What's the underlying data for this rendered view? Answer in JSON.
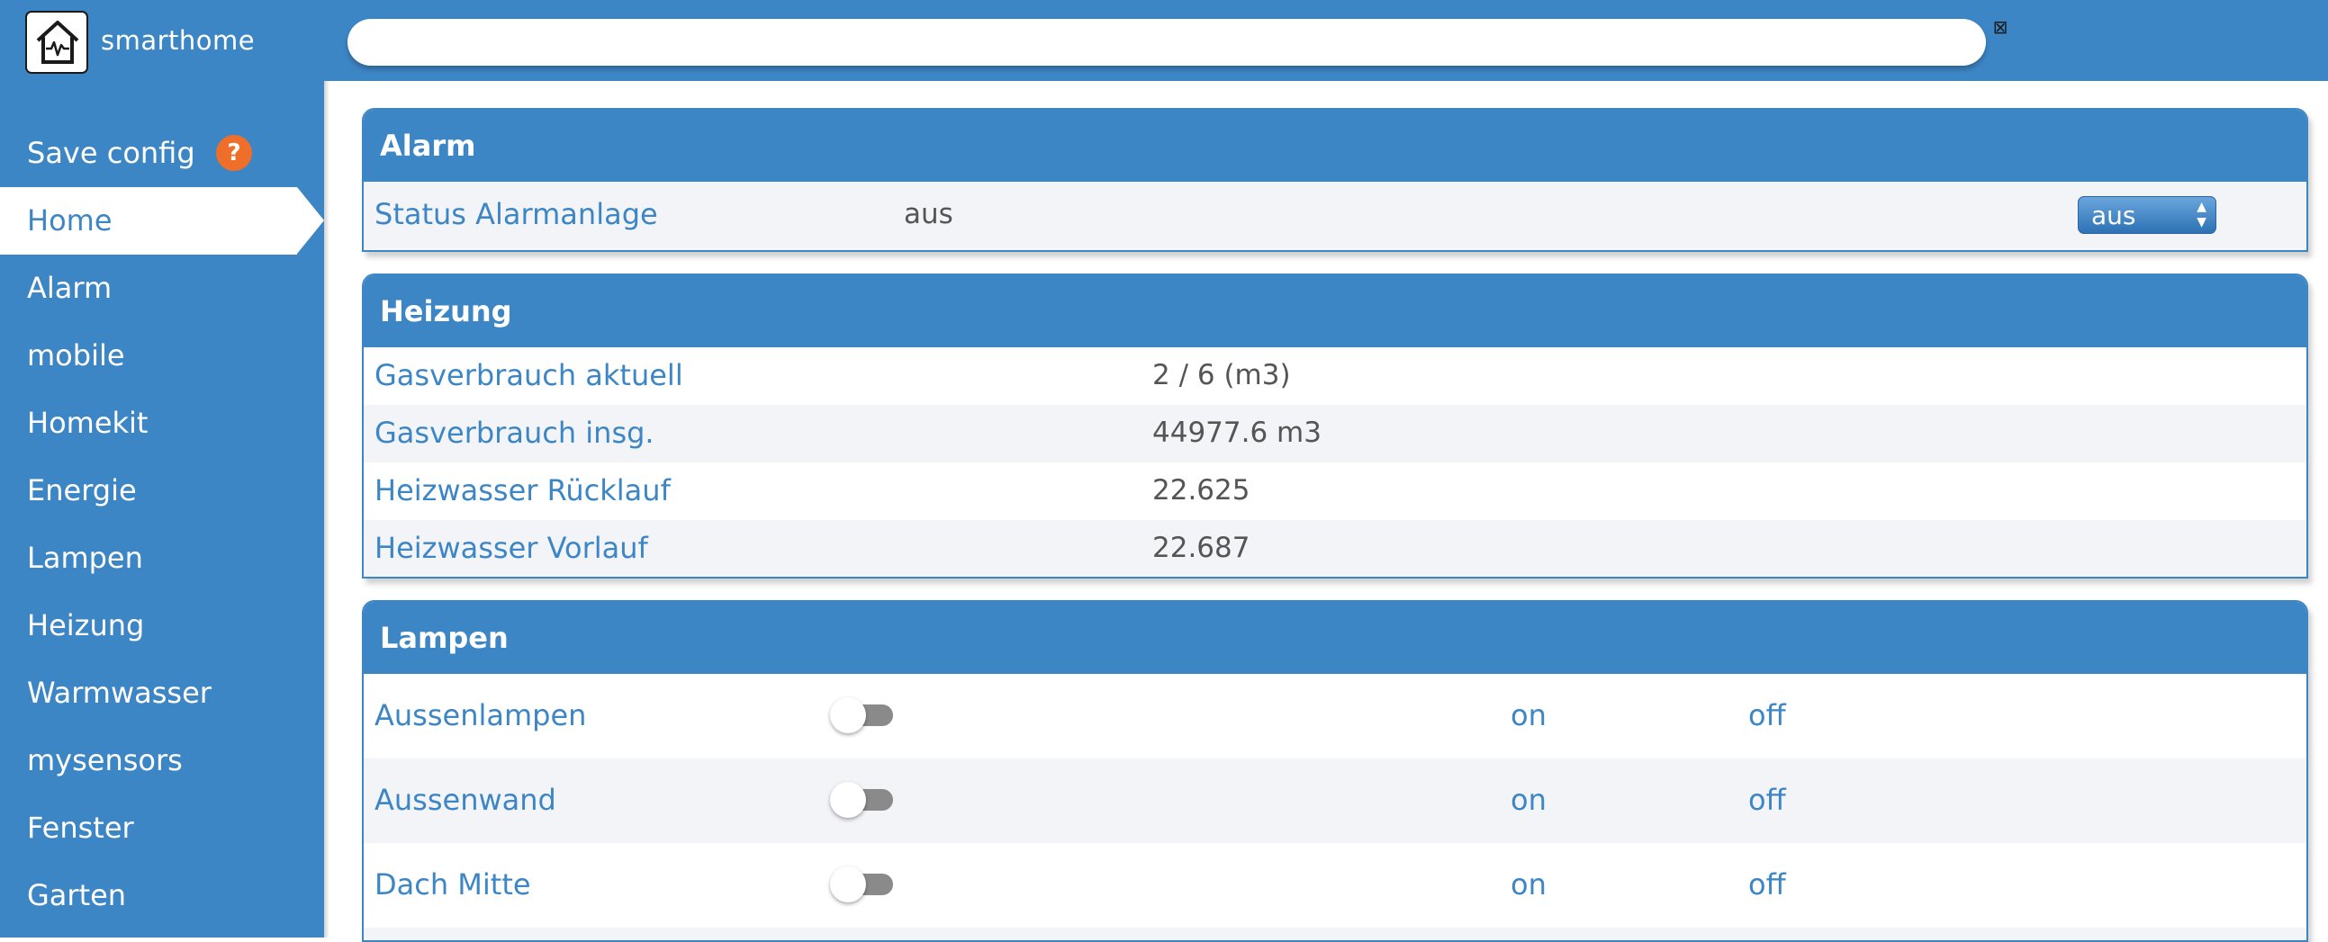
{
  "app": {
    "title": "smarthome",
    "logo_icon": "smarthome-house-icon"
  },
  "search": {
    "value": "",
    "placeholder": "",
    "clear_icon": "clear-x-icon"
  },
  "sidebar": {
    "save_label": "Save config",
    "help_badge": "?",
    "items": [
      {
        "label": "Home",
        "active": true
      },
      {
        "label": "Alarm"
      },
      {
        "label": "mobile"
      },
      {
        "label": "Homekit"
      },
      {
        "label": "Energie"
      },
      {
        "label": "Lampen"
      },
      {
        "label": "Heizung"
      },
      {
        "label": "Warmwasser"
      },
      {
        "label": "mysensors"
      },
      {
        "label": "Fenster"
      },
      {
        "label": "Garten"
      }
    ]
  },
  "alarm": {
    "title": "Alarm",
    "label": "Status Alarmanlage",
    "value": "aus",
    "select_value": "aus"
  },
  "heizung": {
    "title": "Heizung",
    "rows": [
      {
        "label": "Gasverbrauch aktuell",
        "value": "2 / 6 (m3)"
      },
      {
        "label": "Gasverbrauch insg.",
        "value": "44977.6 m3"
      },
      {
        "label": "Heizwasser Rücklauf",
        "value": "22.625"
      },
      {
        "label": "Heizwasser Vorlauf",
        "value": "22.687"
      }
    ]
  },
  "lampen": {
    "title": "Lampen",
    "on_label": "on",
    "off_label": "off",
    "rows": [
      {
        "label": "Aussenlampen",
        "state": "off"
      },
      {
        "label": "Aussenwand",
        "state": "off"
      },
      {
        "label": "Dach Mitte",
        "state": "off"
      }
    ]
  },
  "colors": {
    "accent": "#3d86c6",
    "help_badge": "#ee6e2a",
    "row_alt": "#f3f4f7",
    "value_text": "#555555"
  }
}
